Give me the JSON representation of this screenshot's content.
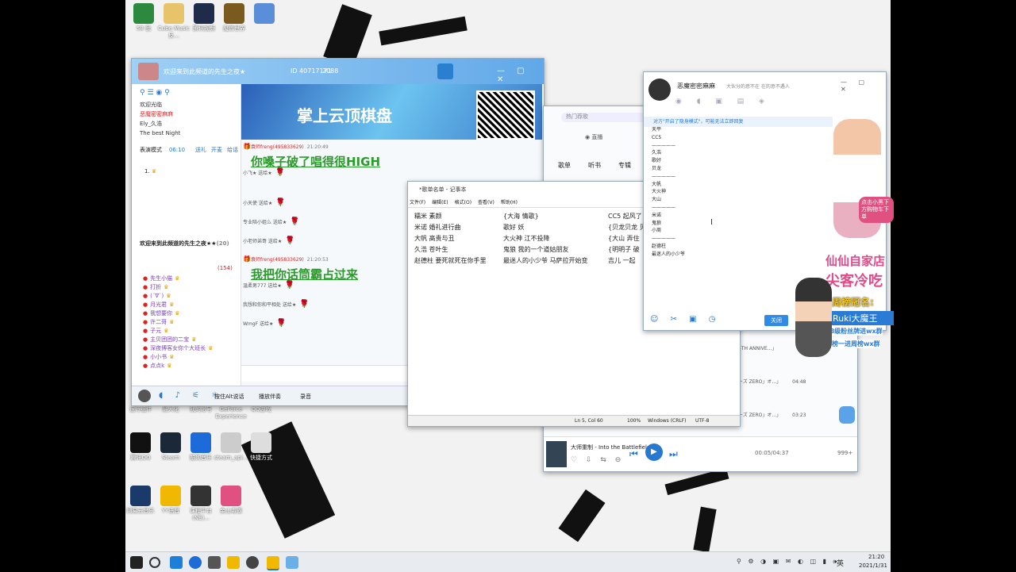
{
  "desktop": {
    "icons_top": [
      {
        "label": "58 我",
        "color": "#2b8a3e"
      },
      {
        "label": "Cube Music 反...",
        "color": "#e7c36a"
      },
      {
        "label": "腾讯视频",
        "color": "#1e2b4a"
      },
      {
        "label": "魔兽世界",
        "color": "#7a5a1e"
      },
      {
        "label": "",
        "color": "#5b8ed8"
      }
    ],
    "icons_mid": [
      {
        "label": "运行组件"
      },
      {
        "label": "最大化"
      },
      {
        "label": "我的帐号"
      },
      {
        "label": "GeForce Experience"
      },
      {
        "label": "QQ游戏"
      }
    ],
    "icons_bottom": [
      {
        "label": "腾讯QQ",
        "color": "#111"
      },
      {
        "label": "Steam",
        "color": "#1b2838"
      },
      {
        "label": "酷狗音乐",
        "color": "#1d6bd8"
      },
      {
        "label": "steam_api...",
        "color": "#ccc"
      },
      {
        "label": "快捷方式",
        "color": "#ddd"
      }
    ],
    "icons_bottom2": [
      {
        "label": "网易云音乐",
        "color": "#1a3a6a"
      },
      {
        "label": "YY语音",
        "color": "#f0b800"
      },
      {
        "label": "课程平台 (NE)...",
        "color": "#333"
      },
      {
        "label": "金山毒霸",
        "color": "#e05080"
      }
    ]
  },
  "yy": {
    "title": "欢迎来到此频道的先生之夜★",
    "room_id": "ID 40717171",
    "online": "2088",
    "sidebar_items": [
      "欢迎光临",
      "恶魔密密麻麻",
      "Ely_久浩",
      "The best Night"
    ],
    "mode_label": "表演模式",
    "mode_time": "06:10",
    "mode_tabs": [
      "送礼",
      "开麦",
      "给话"
    ],
    "queue_item": "1.",
    "channel_header": "欢迎来到此频道的先生之夜★★",
    "channel_count": "(20)",
    "members_count": "(154)",
    "members": [
      "先生小猫",
      "打折",
      "(´∇`)",
      "月光君",
      "我想要你",
      "许二哥",
      "子元",
      "主贝团团的二宝",
      "深夜博客女你个大班长",
      "小小书",
      "点点k"
    ],
    "banner_text": "掌上云顶棋盘",
    "chat": [
      {
        "user": "袁师freng(495833629)",
        "time": "21:20:49",
        "msg": "你嗓子破了唱得很HIGH"
      },
      {
        "user": "小飞★ 送给★",
        "time": "",
        "msg": ""
      },
      {
        "user": "小天使 送给★",
        "time": "",
        "msg": ""
      },
      {
        "user": "专业陪小姐么 送给★",
        "time": "",
        "msg": ""
      },
      {
        "user": "小老师弟哥 送给★",
        "time": "",
        "msg": ""
      },
      {
        "user": "袁师freng(495833629)",
        "time": "21:20:53",
        "msg": "我把你话筒霸占过来"
      },
      {
        "user": "温柔男777 送给★",
        "time": "",
        "msg": ""
      },
      {
        "user": "我想和你和平相处 送给★",
        "time": "",
        "msg": ""
      },
      {
        "user": "WmgF 送给★",
        "time": "",
        "msg": ""
      }
    ],
    "bottom_actions": [
      "按住Alt说话",
      "播放伴奏",
      "录音"
    ]
  },
  "notepad": {
    "title": "*歌单名单 - 记事本",
    "menu": [
      "文件(F)",
      "编辑(E)",
      "格式(O)",
      "查看(V)",
      "帮助(H)"
    ],
    "col1": [
      "糯米  素颜",
      "米诺  婚礼进行曲",
      "大帆  高贵与丑",
      "久浩  苍叶生",
      "赵德柱  要死就死在你手里"
    ],
    "col2": [
      "{大海  情歌}",
      "歌好  妖",
      "大火神  江不投降",
      "鬼狼  我的一个道姑朋友",
      "最迷人的小少爷  马萨拉开始变"
    ],
    "col3": [
      "CC5    起风了",
      "{贝龙贝龙  贝",
      "{大山   弄住",
      "{明明子   破",
      "吉儿   一起"
    ],
    "status": [
      "Ln 5, Col 60",
      "100%",
      "Windows (CRLF)",
      "UTF-8"
    ]
  },
  "music": {
    "nav": [
      "歌单",
      "听书",
      "专辑"
    ],
    "live": "直播",
    "search": "热门荐歌",
    "rows": [
      {
        "title": "5TH ANNIVE...」",
        "duration": ""
      },
      {
        "title": "ーズ ZERO」オ...」",
        "duration": "04:48"
      },
      {
        "title": "ーズ ZERO」オ...」",
        "duration": "03:23"
      }
    ],
    "now_playing": "大师重制 - Into the Battlefield II",
    "time": "00:05/04:37",
    "count": "999+"
  },
  "qqchat": {
    "title": "恶魔密密麻麻",
    "subtitle": "大伙分的意不在  在的意不遇人",
    "notice": "对方\"开启了隐身模式\"，可能无法立即回复",
    "lines": [
      "天平",
      "CC5",
      "—————",
      "久浩",
      "歌好",
      "贝龙",
      "—————",
      "大帆",
      "大火神",
      "大山",
      "—————",
      "米诺",
      "鬼狼",
      "小周",
      "—————",
      "赵德柱",
      "最迷人的小少爷"
    ],
    "close_btn": "关闭"
  },
  "overlay": {
    "cart_text": "点击小黑下方购物车下单",
    "shop_name": "仙仙自家店",
    "shop_slogan": "尖客冷吃",
    "weekly": "周榜冠名:",
    "champion": "Ruki大魔王",
    "fans": "18级粉丝牌进wx群",
    "fans2": "周榜一进周榜wx群"
  },
  "taskbar": {
    "lang": "英",
    "time": "21:20",
    "date": "2021/1/31"
  }
}
